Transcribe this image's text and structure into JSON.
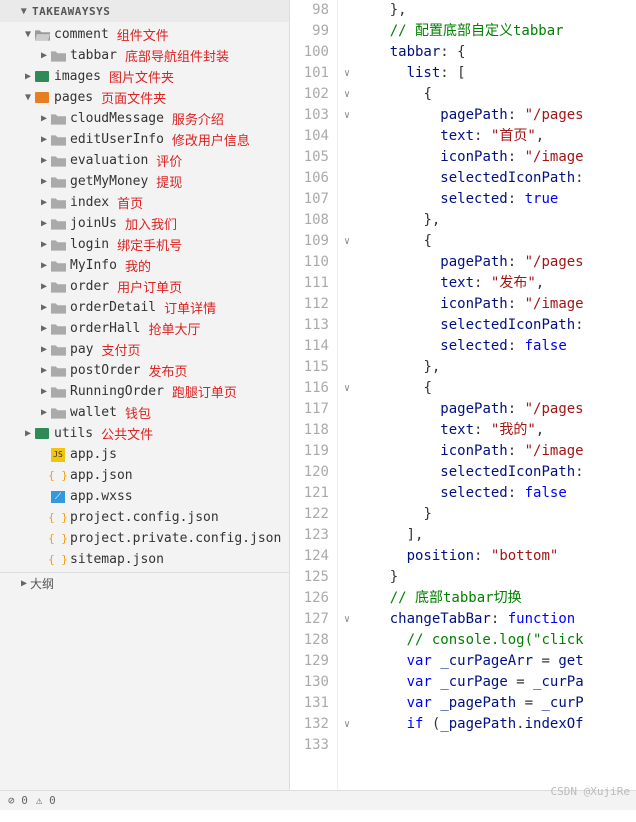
{
  "project": "TAKEAWAYSYS",
  "tree": [
    {
      "indent": 1,
      "chev": "▼",
      "ico": "folder-open",
      "label": "comment",
      "anno": "组件文件"
    },
    {
      "indent": 2,
      "chev": "▶",
      "ico": "folder",
      "label": "tabbar",
      "anno": "底部导航组件封装"
    },
    {
      "indent": 1,
      "chev": "▶",
      "ico": "folder-green",
      "label": "images",
      "anno": "图片文件夹"
    },
    {
      "indent": 1,
      "chev": "▼",
      "ico": "folder-orange",
      "label": "pages",
      "anno": "页面文件夹"
    },
    {
      "indent": 2,
      "chev": "▶",
      "ico": "folder",
      "label": "cloudMessage",
      "anno": "服务介绍"
    },
    {
      "indent": 2,
      "chev": "▶",
      "ico": "folder",
      "label": "editUserInfo",
      "anno": "修改用户信息"
    },
    {
      "indent": 2,
      "chev": "▶",
      "ico": "folder",
      "label": "evaluation",
      "anno": "评价"
    },
    {
      "indent": 2,
      "chev": "▶",
      "ico": "folder",
      "label": "getMyMoney",
      "anno": "提现"
    },
    {
      "indent": 2,
      "chev": "▶",
      "ico": "folder",
      "label": "index",
      "anno": "首页"
    },
    {
      "indent": 2,
      "chev": "▶",
      "ico": "folder",
      "label": "joinUs",
      "anno": "加入我们"
    },
    {
      "indent": 2,
      "chev": "▶",
      "ico": "folder",
      "label": "login",
      "anno": "绑定手机号"
    },
    {
      "indent": 2,
      "chev": "▶",
      "ico": "folder",
      "label": "MyInfo",
      "anno": "我的"
    },
    {
      "indent": 2,
      "chev": "▶",
      "ico": "folder",
      "label": "order",
      "anno": "用户订单页"
    },
    {
      "indent": 2,
      "chev": "▶",
      "ico": "folder",
      "label": "orderDetail",
      "anno": "订单详情"
    },
    {
      "indent": 2,
      "chev": "▶",
      "ico": "folder",
      "label": "orderHall",
      "anno": "抢单大厅"
    },
    {
      "indent": 2,
      "chev": "▶",
      "ico": "folder",
      "label": "pay",
      "anno": "支付页"
    },
    {
      "indent": 2,
      "chev": "▶",
      "ico": "folder",
      "label": "postOrder",
      "anno": "发布页"
    },
    {
      "indent": 2,
      "chev": "▶",
      "ico": "folder",
      "label": "RunningOrder",
      "anno": "跑腿订单页"
    },
    {
      "indent": 2,
      "chev": "▶",
      "ico": "folder",
      "label": "wallet",
      "anno": "钱包"
    },
    {
      "indent": 1,
      "chev": "▶",
      "ico": "folder-green",
      "label": "utils",
      "anno": "公共文件"
    },
    {
      "indent": 2,
      "chev": "",
      "ico": "js",
      "label": "app.js",
      "anno": ""
    },
    {
      "indent": 2,
      "chev": "",
      "ico": "json",
      "label": "app.json",
      "anno": ""
    },
    {
      "indent": 2,
      "chev": "",
      "ico": "wxss",
      "label": "app.wxss",
      "anno": ""
    },
    {
      "indent": 2,
      "chev": "",
      "ico": "json",
      "label": "project.config.json",
      "anno": ""
    },
    {
      "indent": 2,
      "chev": "",
      "ico": "json",
      "label": "project.private.config.json",
      "anno": ""
    },
    {
      "indent": 2,
      "chev": "",
      "ico": "json",
      "label": "sitemap.json",
      "anno": ""
    }
  ],
  "outline": "大纲",
  "status": {
    "err": "0",
    "warn": "0"
  },
  "lines": {
    "start": 98,
    "end": 133
  },
  "fold_marks": {
    "101": "∨",
    "102": "∨",
    "103": "∨",
    "109": "∨",
    "116": "∨",
    "127": "∨",
    "132": "∨"
  },
  "code": [
    {
      "n": 98,
      "html": "    <span class='punc'>},</span>"
    },
    {
      "n": 99,
      "html": "    <span class='com'>// 配置底部自定义tabbar</span>"
    },
    {
      "n": 100,
      "html": "    <span class='key'>tabbar</span><span class='punc'>:</span> <span class='punc'>{</span>"
    },
    {
      "n": 101,
      "html": "      <span class='key'>list</span><span class='punc'>:</span> <span class='punc'>[</span>"
    },
    {
      "n": 102,
      "html": "        <span class='punc'>{</span>"
    },
    {
      "n": 103,
      "html": "          <span class='key'>pagePath</span><span class='punc'>:</span> <span class='str'>\"/pages</span>"
    },
    {
      "n": 104,
      "html": "          <span class='key'>text</span><span class='punc'>:</span> <span class='str'>\"首页\"</span><span class='punc'>,</span>"
    },
    {
      "n": 105,
      "html": "          <span class='key'>iconPath</span><span class='punc'>:</span> <span class='str'>\"/image</span>"
    },
    {
      "n": 106,
      "html": "          <span class='key'>selectedIconPath</span><span class='punc'>:</span>"
    },
    {
      "n": 107,
      "html": "          <span class='key'>selected</span><span class='punc'>:</span> <span class='bool'>true</span>"
    },
    {
      "n": 108,
      "html": "        <span class='punc'>},</span>"
    },
    {
      "n": 109,
      "html": "        <span class='punc'>{</span>"
    },
    {
      "n": 110,
      "html": "          <span class='key'>pagePath</span><span class='punc'>:</span> <span class='str'>\"/pages</span>"
    },
    {
      "n": 111,
      "html": "          <span class='key'>text</span><span class='punc'>:</span> <span class='str'>\"发布\"</span><span class='punc'>,</span>"
    },
    {
      "n": 112,
      "html": "          <span class='key'>iconPath</span><span class='punc'>:</span> <span class='str'>\"/image</span>"
    },
    {
      "n": 113,
      "html": "          <span class='key'>selectedIconPath</span><span class='punc'>:</span>"
    },
    {
      "n": 114,
      "html": "          <span class='key'>selected</span><span class='punc'>:</span> <span class='bool'>false</span>"
    },
    {
      "n": 115,
      "html": "        <span class='punc'>},</span>"
    },
    {
      "n": 116,
      "html": "        <span class='punc'>{</span>"
    },
    {
      "n": 117,
      "html": "          <span class='key'>pagePath</span><span class='punc'>:</span> <span class='str'>\"/pages</span>"
    },
    {
      "n": 118,
      "html": "          <span class='key'>text</span><span class='punc'>:</span> <span class='str'>\"我的\"</span><span class='punc'>,</span>"
    },
    {
      "n": 119,
      "html": "          <span class='key'>iconPath</span><span class='punc'>:</span> <span class='str'>\"/image</span>"
    },
    {
      "n": 120,
      "html": "          <span class='key'>selectedIconPath</span><span class='punc'>:</span>"
    },
    {
      "n": 121,
      "html": "          <span class='key'>selected</span><span class='punc'>:</span> <span class='bool'>false</span>"
    },
    {
      "n": 122,
      "html": "        <span class='punc'>}</span>"
    },
    {
      "n": 123,
      "html": "      <span class='punc'>],</span>"
    },
    {
      "n": 124,
      "html": "      <span class='key'>position</span><span class='punc'>:</span> <span class='str'>\"bottom\"</span>"
    },
    {
      "n": 125,
      "html": "    <span class='punc'>}</span>"
    },
    {
      "n": 126,
      "html": "    <span class='com'>// 底部tabbar切换</span>"
    },
    {
      "n": 127,
      "html": "    <span class='key'>changeTabBar</span><span class='punc'>:</span> <span class='kw'>function</span> "
    },
    {
      "n": 128,
      "html": "      <span class='com'>// console.log(\"click</span>"
    },
    {
      "n": 129,
      "html": "      <span class='kw'>var</span> <span class='key'>_curPageArr</span> <span class='punc'>=</span> <span class='key'>get</span>"
    },
    {
      "n": 130,
      "html": "      <span class='kw'>var</span> <span class='key'>_curPage</span> <span class='punc'>=</span> <span class='key'>_curPa</span>"
    },
    {
      "n": 131,
      "html": "      <span class='kw'>var</span> <span class='key'>_pagePath</span> <span class='punc'>=</span> <span class='key'>_curP</span>"
    },
    {
      "n": 132,
      "html": "      <span class='kw'>if</span> <span class='punc'>(</span><span class='key'>_pagePath</span><span class='punc'>.</span><span class='key'>indexOf</span>"
    },
    {
      "n": 133,
      "html": "        "
    }
  ],
  "watermark": "CSDN @XujiRe"
}
